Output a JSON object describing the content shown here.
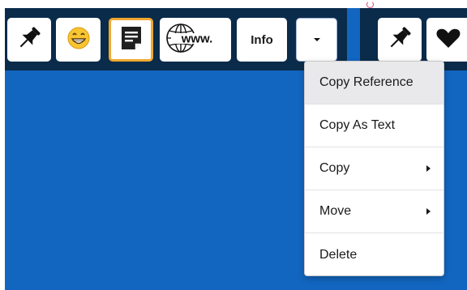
{
  "colors": {
    "toolbar_bg": "#0a2b4a",
    "content_bg": "#1266c0",
    "selected_border": "#f0a830",
    "menu_hover": "#e9e9ec"
  },
  "toolbar": {
    "buttons": [
      {
        "name": "pin-button",
        "icon": "pushpin-icon"
      },
      {
        "name": "emoji-button",
        "icon": "grinning-face-icon"
      },
      {
        "name": "note-button",
        "icon": "note-icon",
        "selected": true
      },
      {
        "name": "web-link-button",
        "icon": "globe-www-icon"
      },
      {
        "name": "info-button",
        "label": "Info"
      },
      {
        "name": "more-dropdown-button",
        "icon": "caret-down-icon"
      }
    ],
    "secondary_buttons": [
      {
        "name": "pin-button-2",
        "icon": "pushpin-icon"
      },
      {
        "name": "heart-button",
        "icon": "heart-icon"
      }
    ]
  },
  "menu": {
    "items": [
      {
        "label": "Copy Reference",
        "highlighted": true,
        "submenu": false
      },
      {
        "label": "Copy As Text",
        "submenu": false
      },
      {
        "label": "Copy",
        "submenu": true
      },
      {
        "label": "Move",
        "submenu": true
      },
      {
        "label": "Delete",
        "submenu": false
      }
    ]
  }
}
